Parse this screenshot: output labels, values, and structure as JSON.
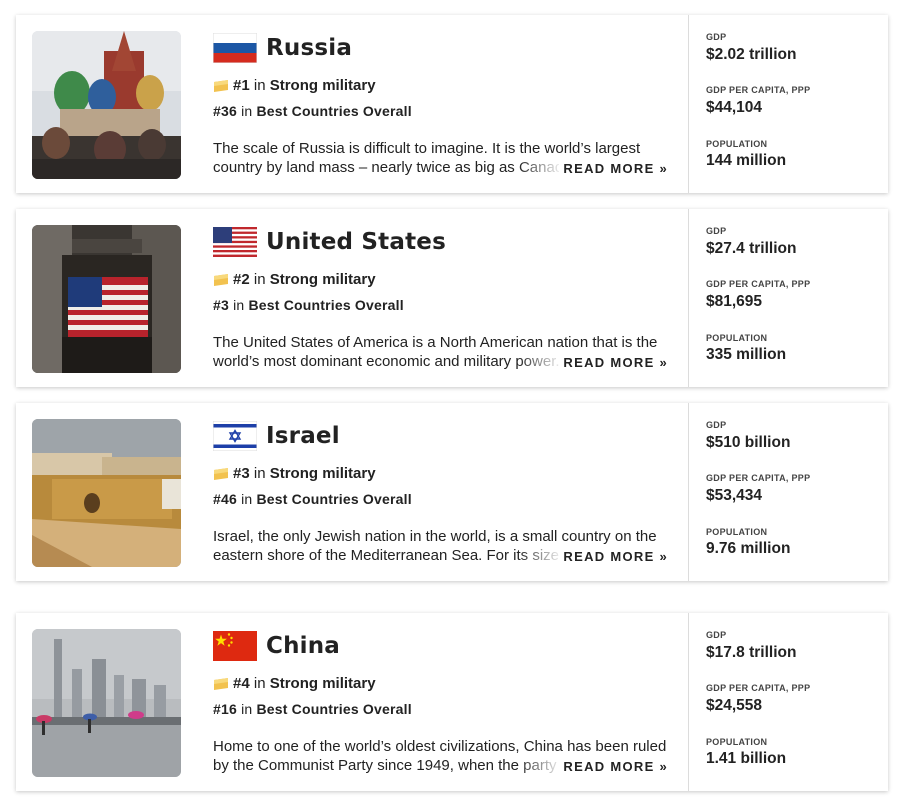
{
  "labels": {
    "in_text": "in",
    "read_more": "READ MORE »",
    "gdp": "GDP",
    "gdp_per_capita": "GDP PER CAPITA, PPP",
    "population": "POPULATION"
  },
  "countries": [
    {
      "name": "Russia",
      "rank": "#1",
      "category": "Strong military",
      "overall_rank": "#36",
      "overall_label": "Best Countries Overall",
      "description": "The scale of Russia is difficult to imagine. It is the world’s largest country by land mass – nearly twice as big as Canada, the",
      "gdp": "$2.02 trillion",
      "gdp_per_capita": "$44,104",
      "population": "144 million"
    },
    {
      "name": "United States",
      "rank": "#2",
      "category": "Strong military",
      "overall_rank": "#3",
      "overall_label": "Best Countries Overall",
      "description": "The United States of America is a North American nation that is the world’s most dominant economic and military power.",
      "gdp": "$27.4 trillion",
      "gdp_per_capita": "$81,695",
      "population": "335 million"
    },
    {
      "name": "Israel",
      "rank": "#3",
      "category": "Strong military",
      "overall_rank": "#46",
      "overall_label": "Best Countries Overall",
      "description": "Israel, the only Jewish nation in the world, is a small country on the eastern shore of the Mediterranean Sea. For its size,",
      "gdp": "$510 billion",
      "gdp_per_capita": "$53,434",
      "population": "9.76 million"
    },
    {
      "name": "China",
      "rank": "#4",
      "category": "Strong military",
      "overall_rank": "#16",
      "overall_label": "Best Countries Overall",
      "description": "Home to one of the world’s oldest civilizations, China has been ruled by the Communist Party since 1949, when the party",
      "gdp": "$17.8 trillion",
      "gdp_per_capita": "$24,558",
      "population": "1.41 billion"
    }
  ]
}
